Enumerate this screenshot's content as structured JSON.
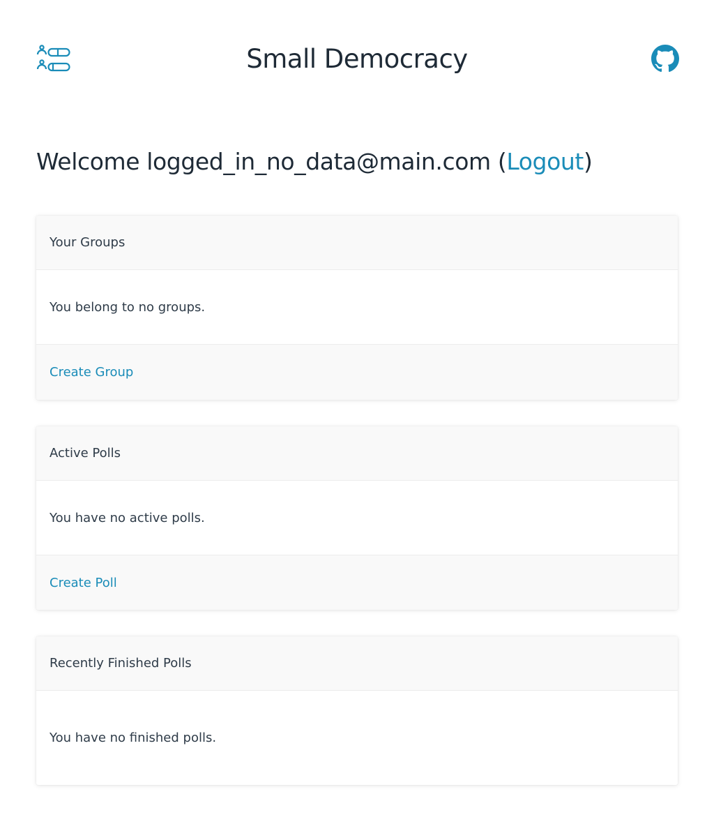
{
  "header": {
    "title": "Small Democracy",
    "logo_icon": "group-list-icon",
    "github_icon": "github-icon",
    "accent_color": "#1a8cb8"
  },
  "welcome": {
    "prefix": "Welcome logged_in_no_data@main.com (",
    "logout_label": "Logout",
    "suffix": ")"
  },
  "groups_card": {
    "title": "Your Groups",
    "message": "You belong to no groups.",
    "action_label": "Create Group"
  },
  "active_polls_card": {
    "title": "Active Polls",
    "message": "You have no active polls.",
    "action_label": "Create Poll"
  },
  "finished_polls_card": {
    "title": "Recently Finished Polls",
    "message": "You have no finished polls."
  }
}
